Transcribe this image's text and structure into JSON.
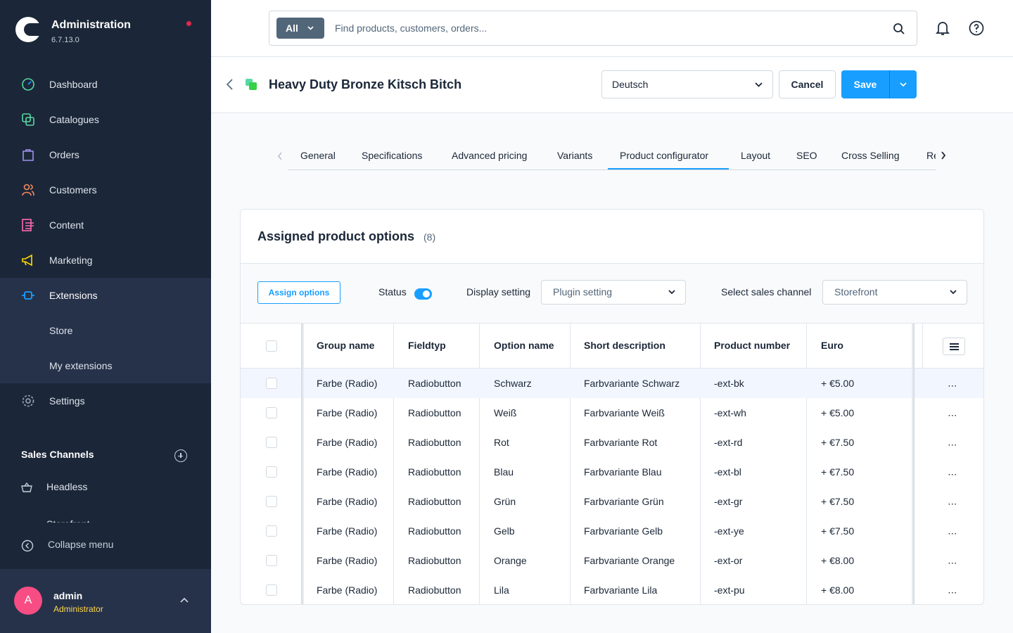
{
  "sidebar": {
    "brand_title": "Administration",
    "version": "6.7.13.0",
    "nav": [
      {
        "label": "Dashboard",
        "icon": "dashboard-icon",
        "color": "#57d9a3"
      },
      {
        "label": "Catalogues",
        "icon": "catalogue-icon",
        "color": "#57d9a3"
      },
      {
        "label": "Orders",
        "icon": "orders-icon",
        "color": "#a092f0"
      },
      {
        "label": "Customers",
        "icon": "customers-icon",
        "color": "#f88962"
      },
      {
        "label": "Content",
        "icon": "content-icon",
        "color": "#ff68b4"
      },
      {
        "label": "Marketing",
        "icon": "marketing-icon",
        "color": "#ffd700"
      },
      {
        "label": "Extensions",
        "icon": "extensions-icon",
        "color": "#189eff"
      },
      {
        "label": "Store"
      },
      {
        "label": "My extensions"
      },
      {
        "label": "Settings",
        "icon": "settings-icon",
        "color": "#9aa8b5"
      }
    ],
    "sales_channels_label": "Sales Channels",
    "sales_channels": [
      {
        "label": "Headless",
        "icon": "basket-icon"
      },
      {
        "label": "Storefront",
        "icon": "storefront-icon"
      }
    ],
    "collapse_label": "Collapse menu",
    "user": {
      "initial": "A",
      "name": "admin",
      "role": "Administrator"
    }
  },
  "topbar": {
    "filter_label": "All",
    "search_placeholder": "Find products, customers, orders..."
  },
  "smartbar": {
    "title": "Heavy Duty Bronze Kitsch Bitch",
    "language": "Deutsch",
    "cancel_label": "Cancel",
    "save_label": "Save"
  },
  "tabs": [
    "General",
    "Specifications",
    "Advanced pricing",
    "Variants",
    "Product configurator",
    "Layout",
    "SEO",
    "Cross Selling",
    "Re"
  ],
  "active_tab": "Product configurator",
  "card": {
    "title": "Assigned product options",
    "count": "(8)",
    "assign_label": "Assign options",
    "status_label": "Status",
    "status_on": true,
    "display_label": "Display setting",
    "display_value": "Plugin setting",
    "channel_label": "Select sales channel",
    "channel_value": "Storefront"
  },
  "grid": {
    "columns": [
      "Group name",
      "Fieldtyp",
      "Option name",
      "Short description",
      "Product number",
      "Euro"
    ],
    "rows": [
      [
        "Farbe (Radio)",
        "Radiobutton",
        "Schwarz",
        "Farbvariante Schwarz",
        "-ext-bk",
        "+ €5.00"
      ],
      [
        "Farbe (Radio)",
        "Radiobutton",
        "Weiß",
        "Farbvariante Weiß",
        "-ext-wh",
        "+ €5.00"
      ],
      [
        "Farbe (Radio)",
        "Radiobutton",
        "Rot",
        "Farbvariante Rot",
        "-ext-rd",
        "+ €7.50"
      ],
      [
        "Farbe (Radio)",
        "Radiobutton",
        "Blau",
        "Farbvariante Blau",
        "-ext-bl",
        "+ €7.50"
      ],
      [
        "Farbe (Radio)",
        "Radiobutton",
        "Grün",
        "Farbvariante Grün",
        "-ext-gr",
        "+ €7.50"
      ],
      [
        "Farbe (Radio)",
        "Radiobutton",
        "Gelb",
        "Farbvariante Gelb",
        "-ext-ye",
        "+ €7.50"
      ],
      [
        "Farbe (Radio)",
        "Radiobutton",
        "Orange",
        "Farbvariante Orange",
        "-ext-or",
        "+ €8.00"
      ],
      [
        "Farbe (Radio)",
        "Radiobutton",
        "Lila",
        "Farbvariante Lila",
        "-ext-pu",
        "+ €8.00"
      ]
    ],
    "row_action": "···"
  }
}
